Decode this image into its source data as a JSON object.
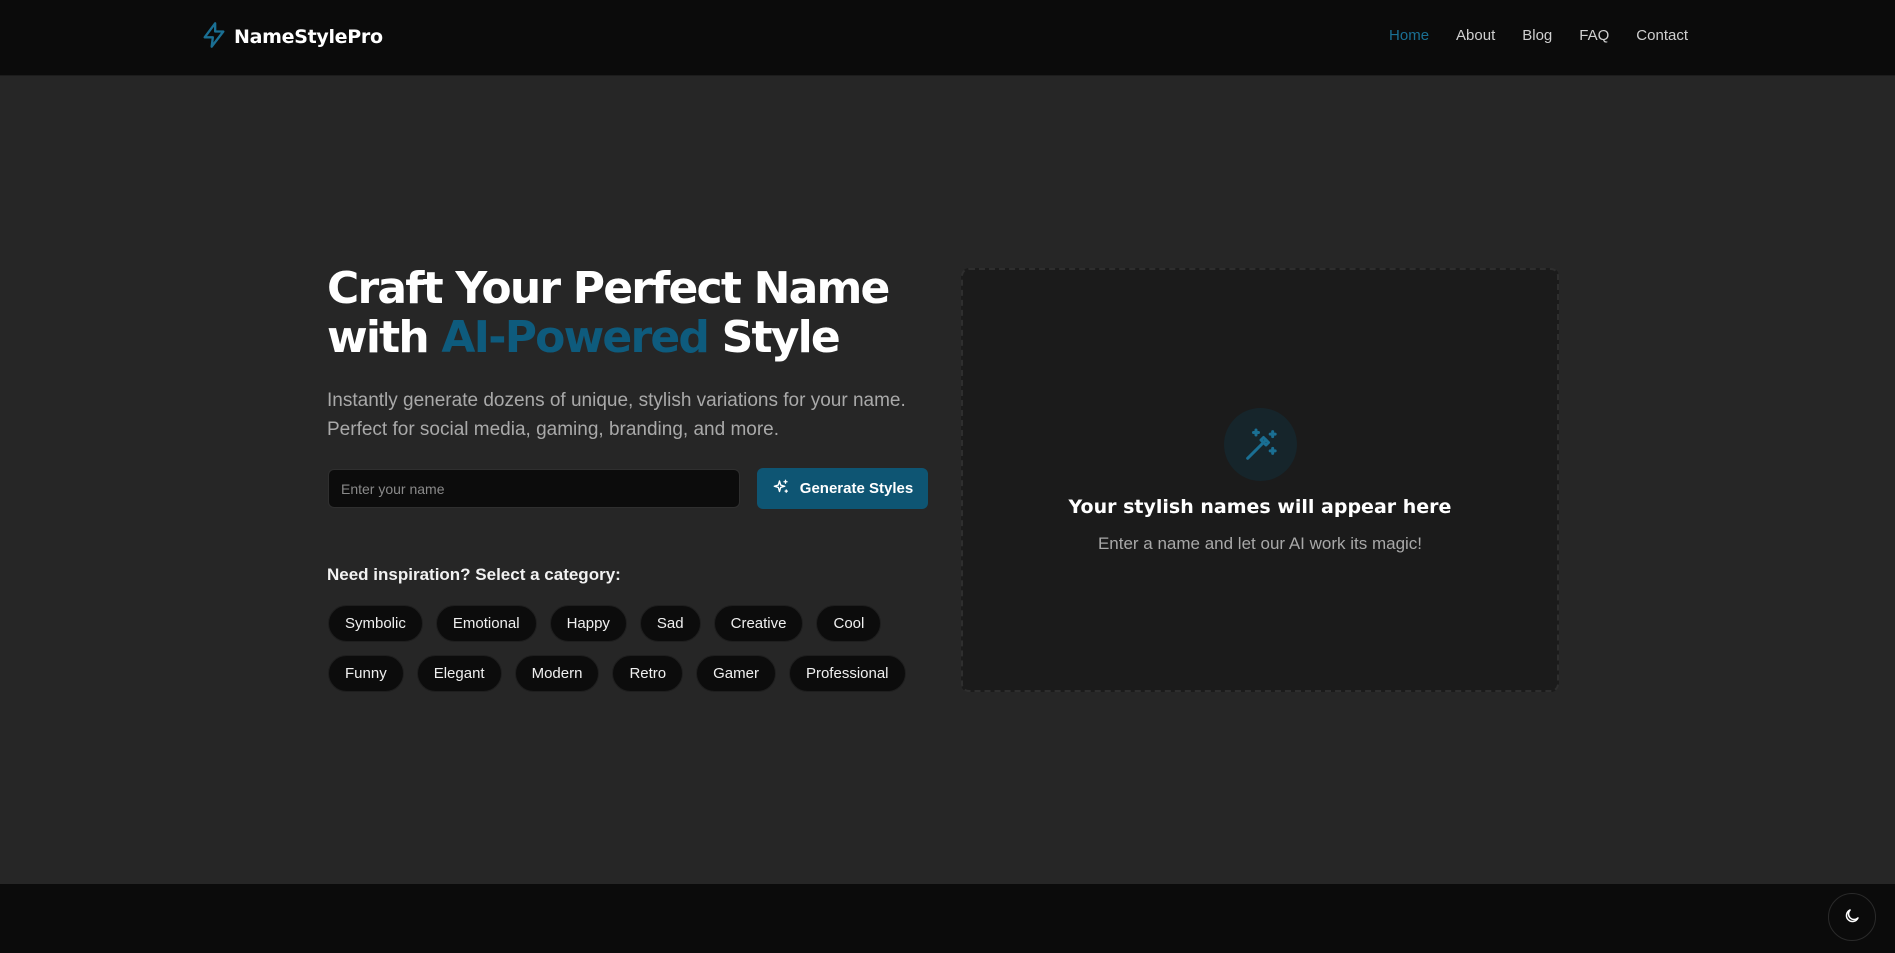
{
  "header": {
    "brand_name": "NameStylePro",
    "brand_icon": "lightning-bolt-icon",
    "nav": [
      {
        "label": "Home",
        "active": true
      },
      {
        "label": "About",
        "active": false
      },
      {
        "label": "Blog",
        "active": false
      },
      {
        "label": "FAQ",
        "active": false
      },
      {
        "label": "Contact",
        "active": false
      }
    ]
  },
  "hero": {
    "title_line1": "Craft Your Perfect Name",
    "title_with": "with ",
    "title_accent": "AI-Powered",
    "title_end": " Style",
    "subtitle_line1": "Instantly generate dozens of unique, stylish variations for your name.",
    "subtitle_line2": "Perfect for social media, gaming, branding, and more.",
    "input_value": "",
    "input_placeholder": "Enter your name",
    "generate_label": "Generate Styles",
    "generate_icon": "sparkles-icon"
  },
  "inspiration": {
    "label": "Need inspiration? Select a category:",
    "row1": [
      "Symbolic",
      "Emotional",
      "Happy",
      "Sad",
      "Creative",
      "Cool"
    ],
    "row2": [
      "Funny",
      "Elegant",
      "Modern",
      "Retro",
      "Gamer",
      "Professional"
    ]
  },
  "result": {
    "icon": "magic-wand-icon",
    "title": "Your stylish names will appear here",
    "subtitle": "Enter a name and let our AI work its magic!"
  },
  "footer": {
    "theme_toggle_icon": "moon-icon"
  },
  "colors": {
    "accent": "#0e5b7d",
    "nav_active": "#1a6f93",
    "button_bg": "#0e5573",
    "page_bg": "#262626",
    "header_bg": "#0b0b0b"
  }
}
